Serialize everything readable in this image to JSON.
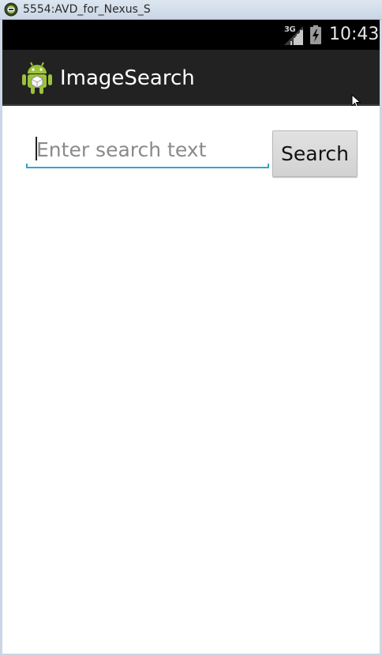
{
  "window": {
    "title": "5554:AVD_for_Nexus_S"
  },
  "status_bar": {
    "network_type": "3G",
    "time": "10:43",
    "icons": [
      "signal-icon",
      "battery-charging-icon"
    ]
  },
  "action_bar": {
    "app_title": "ImageSearch",
    "app_icon": "android-robot-icon"
  },
  "search": {
    "placeholder": "Enter search text",
    "value": "",
    "button_label": "Search"
  },
  "colors": {
    "status_bar_bg": "#000000",
    "action_bar_bg": "#222222",
    "input_underline": "#33a5cf",
    "button_bg": "#d9d9d9",
    "android_green": "#9bc33c"
  }
}
